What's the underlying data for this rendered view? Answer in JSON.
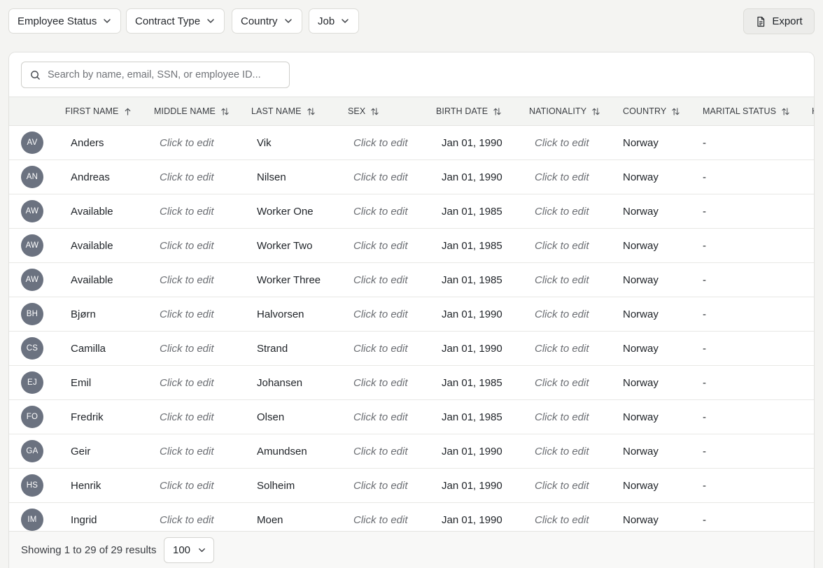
{
  "filters": [
    {
      "label": "Employee Status",
      "icon": "chevron-down-icon"
    },
    {
      "label": "Contract Type",
      "icon": "chevron-down-icon"
    },
    {
      "label": "Country",
      "icon": "chevron-down-icon"
    },
    {
      "label": "Job",
      "icon": "chevron-down-icon"
    }
  ],
  "export": {
    "label": "Export",
    "icon": "file-icon"
  },
  "search": {
    "placeholder": "Search by name, email, SSN, or employee ID...",
    "value": "",
    "icon": "search-icon"
  },
  "columns": [
    {
      "label": "FIRST NAME",
      "sort": "ascending",
      "icon": "arrow-up-icon"
    },
    {
      "label": "MIDDLE NAME",
      "sort": "none",
      "icon": "sort-icon"
    },
    {
      "label": "LAST NAME",
      "sort": "none",
      "icon": "sort-icon"
    },
    {
      "label": "SEX",
      "sort": "none",
      "icon": "sort-icon"
    },
    {
      "label": "BIRTH DATE",
      "sort": "none",
      "icon": "sort-icon"
    },
    {
      "label": "NATIONALITY",
      "sort": "none",
      "icon": "sort-icon"
    },
    {
      "label": "COUNTRY",
      "sort": "none",
      "icon": "sort-icon"
    },
    {
      "label": "MARITAL STATUS",
      "sort": "none",
      "icon": "sort-icon"
    },
    {
      "label": "H",
      "sort": "none",
      "icon": ""
    }
  ],
  "rows": [
    {
      "initials": "AV",
      "first": "Anders",
      "middle": "Click to edit",
      "last": "Vik",
      "sex": "Click to edit",
      "birth": "Jan 01, 1990",
      "nationality": "Click to edit",
      "country": "Norway",
      "marital": "-"
    },
    {
      "initials": "AN",
      "first": "Andreas",
      "middle": "Click to edit",
      "last": "Nilsen",
      "sex": "Click to edit",
      "birth": "Jan 01, 1990",
      "nationality": "Click to edit",
      "country": "Norway",
      "marital": "-"
    },
    {
      "initials": "AW",
      "first": "Available",
      "middle": "Click to edit",
      "last": "Worker One",
      "sex": "Click to edit",
      "birth": "Jan 01, 1985",
      "nationality": "Click to edit",
      "country": "Norway",
      "marital": "-"
    },
    {
      "initials": "AW",
      "first": "Available",
      "middle": "Click to edit",
      "last": "Worker Two",
      "sex": "Click to edit",
      "birth": "Jan 01, 1985",
      "nationality": "Click to edit",
      "country": "Norway",
      "marital": "-"
    },
    {
      "initials": "AW",
      "first": "Available",
      "middle": "Click to edit",
      "last": "Worker Three",
      "sex": "Click to edit",
      "birth": "Jan 01, 1985",
      "nationality": "Click to edit",
      "country": "Norway",
      "marital": "-"
    },
    {
      "initials": "BH",
      "first": "Bjørn",
      "middle": "Click to edit",
      "last": "Halvorsen",
      "sex": "Click to edit",
      "birth": "Jan 01, 1990",
      "nationality": "Click to edit",
      "country": "Norway",
      "marital": "-"
    },
    {
      "initials": "CS",
      "first": "Camilla",
      "middle": "Click to edit",
      "last": "Strand",
      "sex": "Click to edit",
      "birth": "Jan 01, 1990",
      "nationality": "Click to edit",
      "country": "Norway",
      "marital": "-"
    },
    {
      "initials": "EJ",
      "first": "Emil",
      "middle": "Click to edit",
      "last": "Johansen",
      "sex": "Click to edit",
      "birth": "Jan 01, 1985",
      "nationality": "Click to edit",
      "country": "Norway",
      "marital": "-"
    },
    {
      "initials": "FO",
      "first": "Fredrik",
      "middle": "Click to edit",
      "last": "Olsen",
      "sex": "Click to edit",
      "birth": "Jan 01, 1985",
      "nationality": "Click to edit",
      "country": "Norway",
      "marital": "-"
    },
    {
      "initials": "GA",
      "first": "Geir",
      "middle": "Click to edit",
      "last": "Amundsen",
      "sex": "Click to edit",
      "birth": "Jan 01, 1990",
      "nationality": "Click to edit",
      "country": "Norway",
      "marital": "-"
    },
    {
      "initials": "HS",
      "first": "Henrik",
      "middle": "Click to edit",
      "last": "Solheim",
      "sex": "Click to edit",
      "birth": "Jan 01, 1990",
      "nationality": "Click to edit",
      "country": "Norway",
      "marital": "-"
    },
    {
      "initials": "IM",
      "first": "Ingrid",
      "middle": "Click to edit",
      "last": "Moen",
      "sex": "Click to edit",
      "birth": "Jan 01, 1990",
      "nationality": "Click to edit",
      "country": "Norway",
      "marital": "-"
    }
  ],
  "footer": {
    "summary": "Showing 1 to 29 of 29 results",
    "page_size": "100",
    "icon": "chevron-down-icon"
  },
  "colors": {
    "avatar_bg": "#6b7280",
    "page_bg": "#f4f4f2",
    "header_bg": "#f3f4f2"
  }
}
